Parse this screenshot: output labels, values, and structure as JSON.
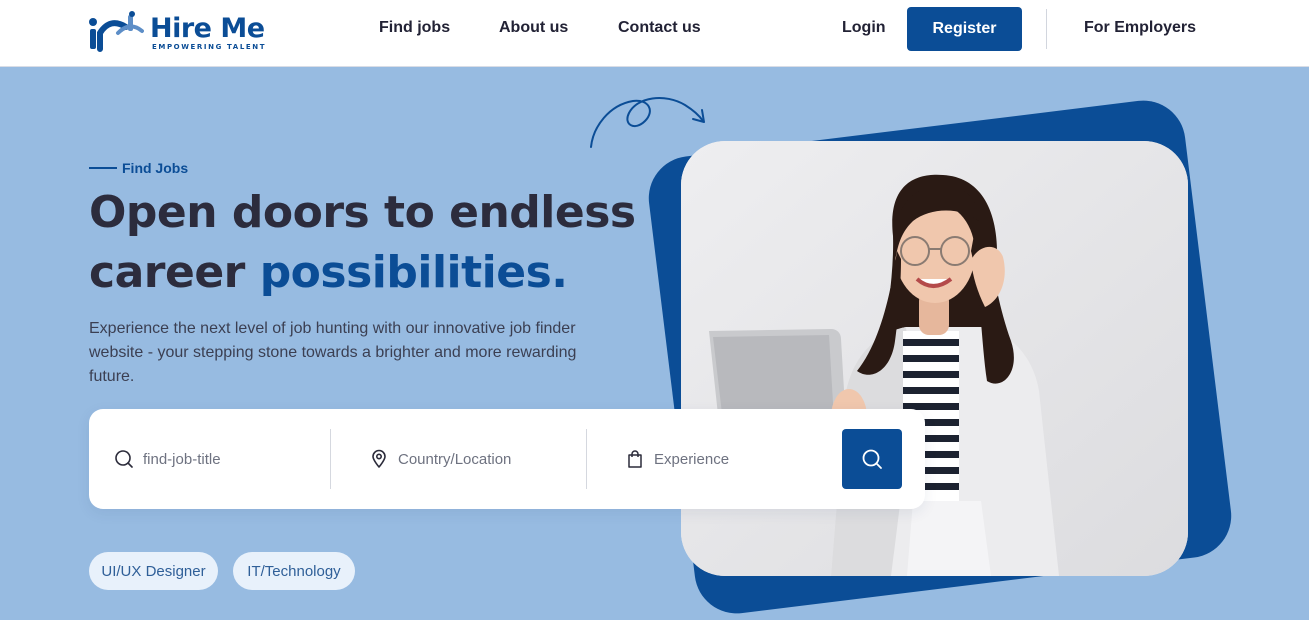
{
  "header": {
    "logo": {
      "title": "Hire Me",
      "tagline": "EMPOWERING TALENT"
    },
    "nav": [
      "Find jobs",
      "About us",
      "Contact us"
    ],
    "login_label": "Login",
    "register_label": "Register",
    "employers_label": "For Employers"
  },
  "hero": {
    "eyebrow": "Find Jobs",
    "headline_line1": "Open doors to endless",
    "headline_line2_plain": "career ",
    "headline_line2_accent": "possibilities.",
    "description": "Experience the next level of job hunting with our innovative job finder website - your stepping stone towards a brighter and more rewarding future."
  },
  "search": {
    "job_title_placeholder": "find-job-title",
    "location_placeholder": "Country/Location",
    "experience_placeholder": "Experience",
    "search_icon": "search-icon"
  },
  "tags": [
    "UI/UX Designer",
    "IT/Technology"
  ],
  "colors": {
    "brand": "#0b4d96",
    "hero_bg": "#97bbe1",
    "tag_bg": "#e8f1fb"
  }
}
